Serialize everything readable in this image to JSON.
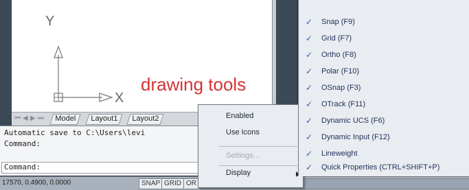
{
  "canvas": {
    "ucs_x_label": "X",
    "ucs_y_label": "Y"
  },
  "overlay_label": "drawing tools",
  "tabs": [
    {
      "label": "Model"
    },
    {
      "label": "Layout1"
    },
    {
      "label": "Layout2"
    }
  ],
  "command": {
    "line1": "Automatic save to C:\\Users\\levi",
    "line2": "Command:",
    "prompt": "Command:"
  },
  "status_bar": {
    "coords": "17570, 0.4900, 0.0000",
    "buttons": [
      "SNAP",
      "GRID",
      "OR"
    ],
    "faint_text": "..."
  },
  "menu1": {
    "items": [
      {
        "label": "Enabled",
        "enabled": true
      },
      {
        "label": "Use Icons",
        "enabled": true
      },
      {
        "label": "Settings...",
        "enabled": false
      },
      {
        "label": "Display",
        "enabled": true,
        "submenu": true
      }
    ]
  },
  "menu2": {
    "items": [
      {
        "label": "Snap (F9)",
        "checked": true
      },
      {
        "label": "Grid (F7)",
        "checked": true
      },
      {
        "label": "Ortho (F8)",
        "checked": true
      },
      {
        "label": "Polar (F10)",
        "checked": true
      },
      {
        "label": "OSnap (F3)",
        "checked": true
      },
      {
        "label": "OTrack (F11)",
        "checked": true
      },
      {
        "label": "Dynamic UCS (F6)",
        "checked": true
      },
      {
        "label": "Dynamic Input (F12)",
        "checked": true
      },
      {
        "label": "Lineweight",
        "checked": true
      },
      {
        "label": "Quick Properties (CTRL+SHIFT+P)",
        "checked": true
      }
    ]
  },
  "icons": {
    "check": "checkmark-icon",
    "submenu_arrow": "submenu-arrow-icon"
  },
  "colors": {
    "overlay_label": "#d63434",
    "check": "#2a5fbf"
  }
}
